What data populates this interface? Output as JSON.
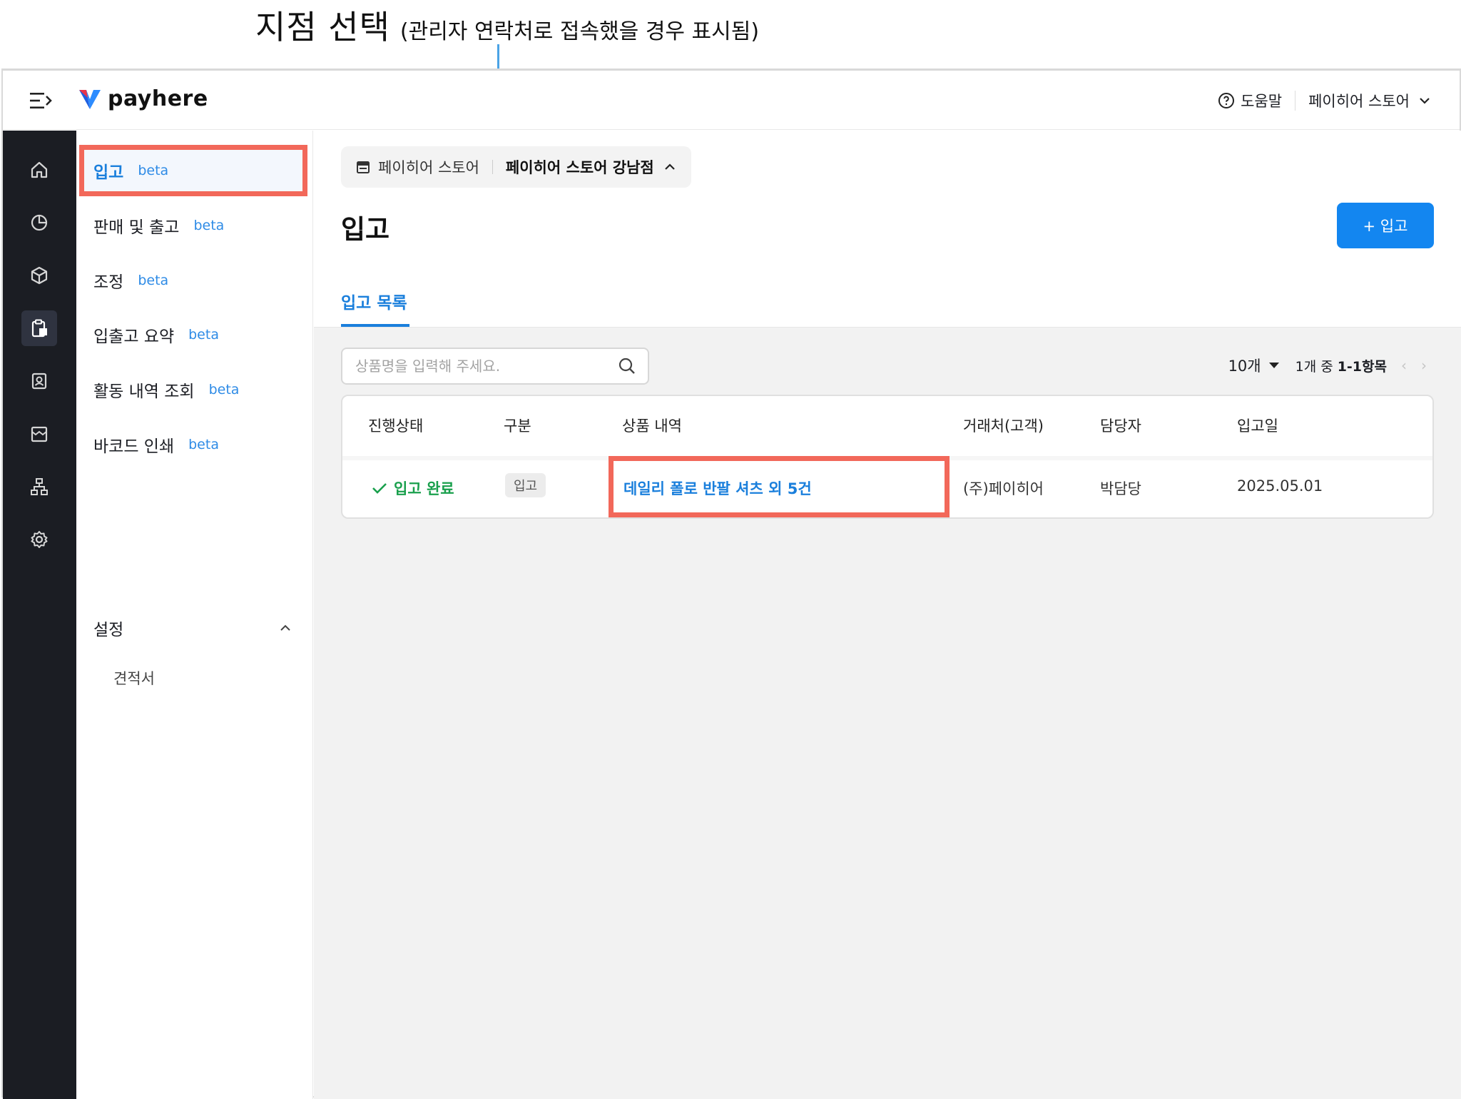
{
  "annotation": {
    "title": "지점 선택",
    "subtitle": "(관리자 연락처로 접속했을 경우 표시됨)"
  },
  "header": {
    "logo_text": "payhere",
    "help_label": "도움말",
    "store_name": "페이히어 스토어"
  },
  "rail": {
    "icons": [
      "home-icon",
      "chart-pie-icon",
      "box-icon",
      "clipboard-icon",
      "contact-icon",
      "store-icon",
      "org-chart-icon",
      "gear-icon"
    ],
    "active_index": 3
  },
  "submenu": {
    "items": [
      {
        "label": "입고",
        "badge": "beta"
      },
      {
        "label": "판매 및 출고",
        "badge": "beta"
      },
      {
        "label": "조정",
        "badge": "beta"
      },
      {
        "label": "입출고 요약",
        "badge": "beta"
      },
      {
        "label": "활동 내역 조회",
        "badge": "beta"
      },
      {
        "label": "바코드 인쇄",
        "badge": "beta"
      }
    ],
    "settings": {
      "label": "설정",
      "children": [
        {
          "label": "견적서"
        }
      ]
    }
  },
  "main": {
    "breadcrumb": {
      "store": "페이히어 스토어",
      "branch": "페이히어 스토어 강남점"
    },
    "title": "입고",
    "add_button": "+ 입고",
    "tab": "입고 목록",
    "search_placeholder": "상품명을 입력해 주세요.",
    "pager": {
      "per_page": "10개",
      "range_prefix": "1개 중",
      "range": "1-1항목"
    },
    "table": {
      "headers": [
        "진행상태",
        "구분",
        "상품 내역",
        "거래처(고객)",
        "담당자",
        "입고일"
      ],
      "rows": [
        {
          "status": "입고 완료",
          "type": "입고",
          "item": "데일리 폴로 반팔 셔츠 외 5건",
          "customer": "(주)페이히어",
          "manager": "박담당",
          "date": "2025.05.01"
        }
      ]
    }
  },
  "colors": {
    "accent": "#1386f0",
    "highlight": "#f2685a",
    "status_ok": "#1aa04d",
    "rail_bg": "#1b1d23"
  }
}
